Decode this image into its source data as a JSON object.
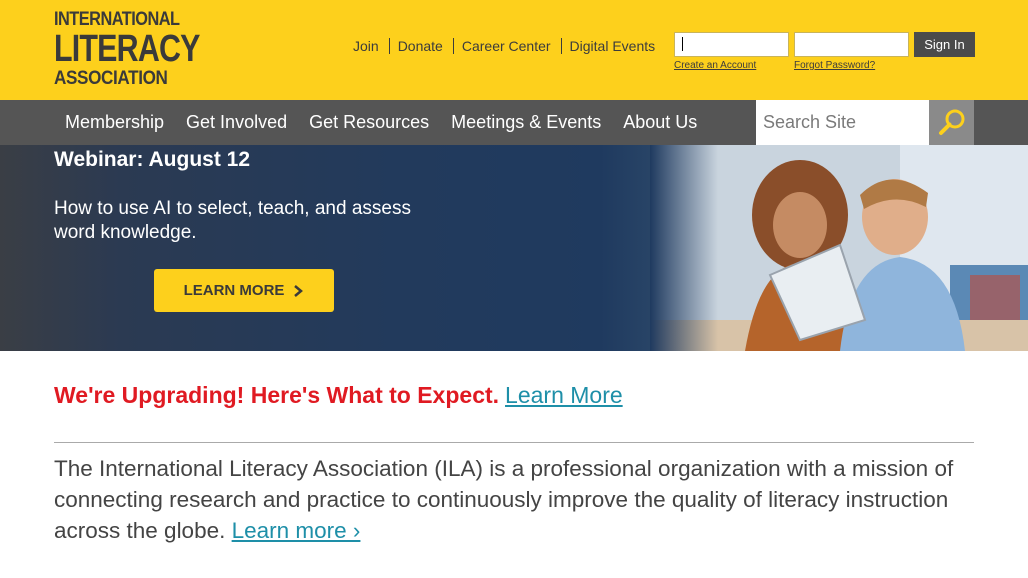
{
  "logo": {
    "line1": "INTERNATIONAL",
    "line2": "LITERACY",
    "line3": "ASSOCIATION"
  },
  "utility_links": [
    "Join",
    "Donate",
    "Career Center",
    "Digital Events"
  ],
  "login": {
    "username_value": "",
    "password_value": "",
    "create_account": "Create an Account",
    "forgot_password": "Forgot Password?",
    "sign_in": "Sign In"
  },
  "nav": {
    "items": [
      "Membership",
      "Get Involved",
      "Get Resources",
      "Meetings & Events",
      "About Us"
    ],
    "search_placeholder": "Search Site"
  },
  "hero": {
    "title": "Webinar: August 12",
    "description": "How to use AI to select, teach, and assess word knowledge.",
    "button": "LEARN MORE"
  },
  "announcement": {
    "text": "We're Upgrading! Here's What to Expect.",
    "link": "Learn More"
  },
  "mission": {
    "text": "The International Literacy Association (ILA) is a professional organization with a mission of connecting research and practice to continuously improve the quality of literacy instruction across the globe.",
    "link": "Learn more ›"
  },
  "colors": {
    "brand_yellow": "#fdd01c",
    "nav_gray": "#555555",
    "alert_red": "#e01a22",
    "link_teal": "#1e8fa8"
  }
}
